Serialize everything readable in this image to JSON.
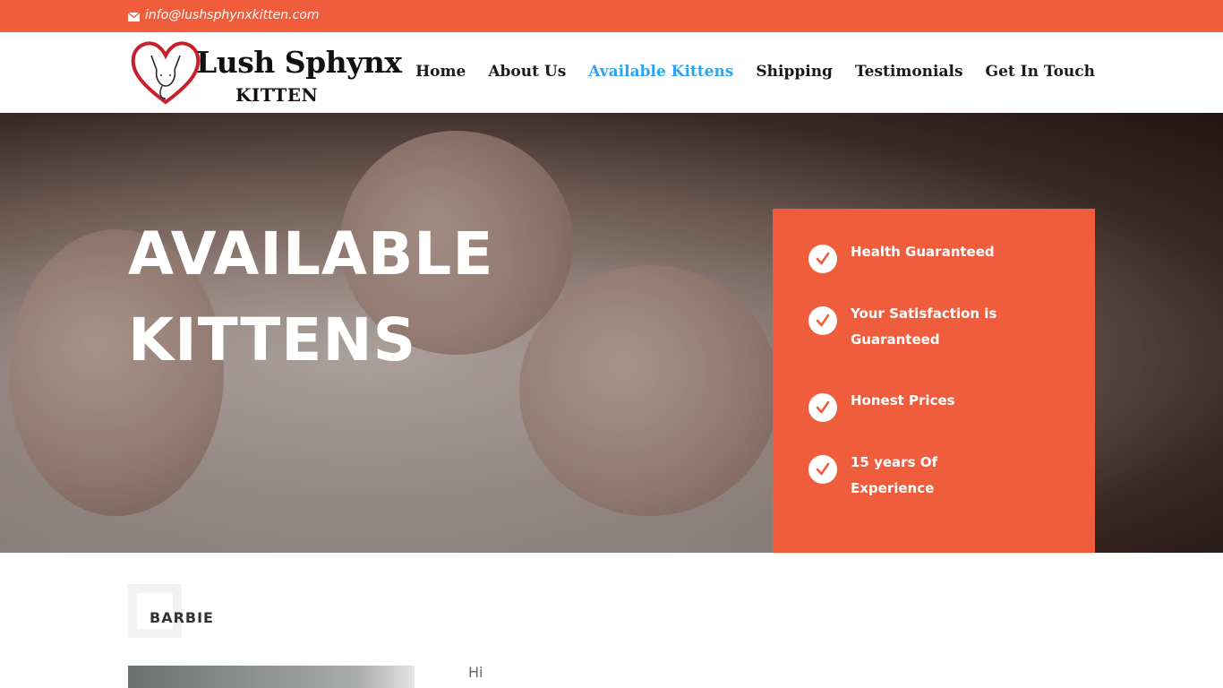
{
  "topbar": {
    "email": "info@lushsphynxkitten.com"
  },
  "logo": {
    "line1": "Lush Sphynx",
    "line2": "KITTEN"
  },
  "nav": {
    "items": [
      "Home",
      "About Us",
      "Available Kittens",
      "Shipping",
      "Testimonials",
      "Get In Touch"
    ],
    "active": "Available Kittens"
  },
  "hero": {
    "title_line1": "AVAILABLE",
    "title_line2": "KITTENS",
    "features": [
      "Health Guaranteed",
      "Your Satisfaction is Guaranteed",
      "Honest Prices",
      "15 years Of Experience"
    ]
  },
  "kitten": {
    "name": "BARBIE",
    "intro": "Hi"
  },
  "colors": {
    "accent": "#f05d3d",
    "link_active": "#2ea3f2"
  }
}
